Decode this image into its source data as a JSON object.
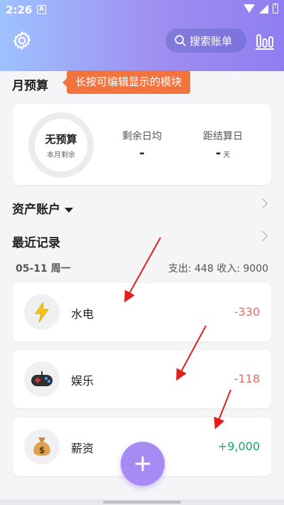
{
  "status": {
    "time": "2:26",
    "notification_badge": "A"
  },
  "header": {
    "settings_icon": "gear-icon",
    "search_label": "搜索账单",
    "stats_icon": "bar-chart-icon"
  },
  "budget": {
    "title": "月预算",
    "tooltip": "长按可编辑显示的模块",
    "ring_title": "无预算",
    "ring_subtitle": "本月剩余",
    "daily_label": "剩余日均",
    "daily_value": "-",
    "settle_label": "距结算日",
    "settle_value": "-",
    "settle_unit": "天"
  },
  "assets": {
    "title": "资产账户"
  },
  "records": {
    "title": "最近记录",
    "date": "05-11 周一",
    "totals": "支出: 448  收入: 9000",
    "items": [
      {
        "name": "水电",
        "amount": "-330",
        "icon": "lightning-icon",
        "type": "expense"
      },
      {
        "name": "娱乐",
        "amount": "-118",
        "icon": "gamepad-icon",
        "type": "expense"
      },
      {
        "name": "薪资",
        "amount": "+9,000",
        "icon": "money-bag-icon",
        "type": "income"
      }
    ]
  },
  "fab": {
    "icon": "plus-icon"
  },
  "colors": {
    "accent": "#a78bf3",
    "tooltip": "#f1733e",
    "expense": "#f0675f",
    "income": "#17a36d",
    "annotation_arrow": "#e11d1d"
  }
}
